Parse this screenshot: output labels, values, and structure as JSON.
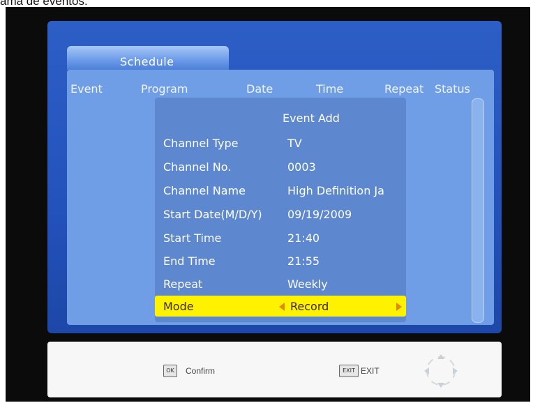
{
  "caption": "ama de eventos:",
  "tab": {
    "label": "Schedule"
  },
  "columns": [
    "Event",
    "Program",
    "Date",
    "Time",
    "Repeat",
    "Status"
  ],
  "dialog": {
    "title": "Event Add",
    "fields": [
      {
        "label": "Channel Type",
        "value": "TV"
      },
      {
        "label": "Channel No.",
        "value": "0003"
      },
      {
        "label": "Channel Name",
        "value": "High Definition Ja"
      },
      {
        "label": "Start Date(M/D/Y)",
        "value": "09/19/2009"
      },
      {
        "label": "Start Time",
        "value": "21:40"
      },
      {
        "label": "End Time",
        "value": "21:55"
      },
      {
        "label": "Repeat",
        "value": "Weekly"
      }
    ],
    "mode": {
      "label": "Mode",
      "value": "Record"
    }
  },
  "footer": {
    "confirm": {
      "key": "OK",
      "label": "Confirm"
    },
    "exit": {
      "key": "EXIT",
      "label": "EXIT"
    }
  },
  "colors": {
    "osd_blue": "#2352bb",
    "panel": "#6f9ee6",
    "dialog": "#5d88cf",
    "highlight": "#fff200"
  },
  "icons": {
    "nav": "directional-pad-icon"
  }
}
